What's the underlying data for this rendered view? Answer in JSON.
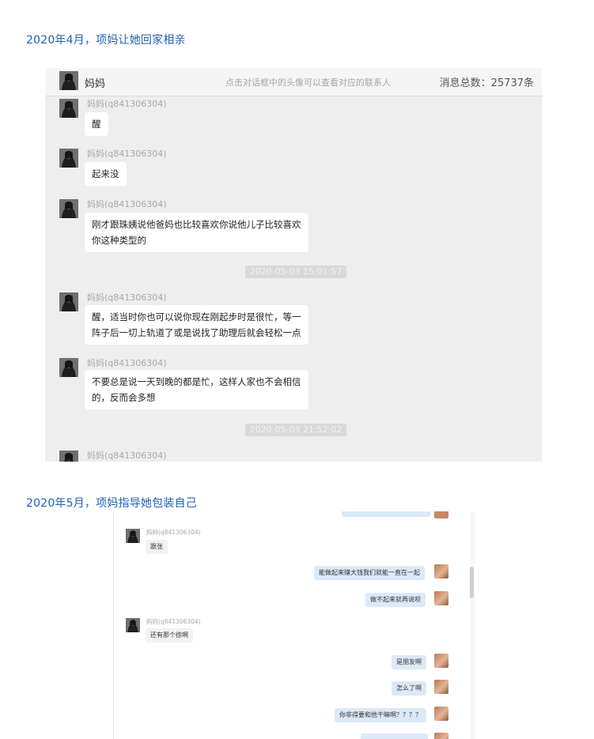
{
  "captions": {
    "first": "2020年4月，项妈让她回家相亲",
    "second": "2020年5月，项妈指导她包装自己"
  },
  "chat1": {
    "header": {
      "contact_name": "妈妈",
      "hint": "点击对话框中的头像可以查看对应的联系人",
      "total_label": "消息总数：",
      "total_count": "25737条"
    },
    "sender": "妈妈(q841306304)",
    "messages": [
      {
        "text": "醒"
      },
      {
        "text": "起来没"
      },
      {
        "text": "刚才跟珠姨说他爸妈也比较喜欢你说他儿子比较喜欢",
        "text2": "你这种类型的"
      },
      {
        "timestamp": "2020-05-03 15:01:57"
      },
      {
        "text": "醒，适当时你也可以说你现在刚起步时是很忙，等一",
        "text2": "阵子后一切上轨道了或是说找了助理后就会轻松一点"
      },
      {
        "text": "不要总是说一天到晚的都是忙，这样人家也不会相信",
        "text2": "的，反而会多想"
      },
      {
        "timestamp": "2020-05-03 21:52:02"
      }
    ]
  },
  "chat2": {
    "sender": "妈妈(q841306304)",
    "messages": [
      {
        "side": "left",
        "text": "跟张"
      },
      {
        "side": "right",
        "text": "能做起来赚大钱我们就能一直在一起"
      },
      {
        "side": "right",
        "text": "做不起来就再说呗"
      },
      {
        "side": "left",
        "text": "还有那个徐啊"
      },
      {
        "side": "right",
        "text": "是朋友啊"
      },
      {
        "side": "right",
        "text": "怎么了啊"
      },
      {
        "side": "right",
        "text": "你非得要和他干嘛啊？？？？"
      }
    ]
  },
  "icons": {
    "mom_avatar": "woman-portrait-avatar",
    "self_avatar": "user-photo-avatar"
  },
  "colors": {
    "caption": "#1f5fb8",
    "chat_bg": "#eeeeee",
    "self_bubble": "#dce9f7"
  }
}
